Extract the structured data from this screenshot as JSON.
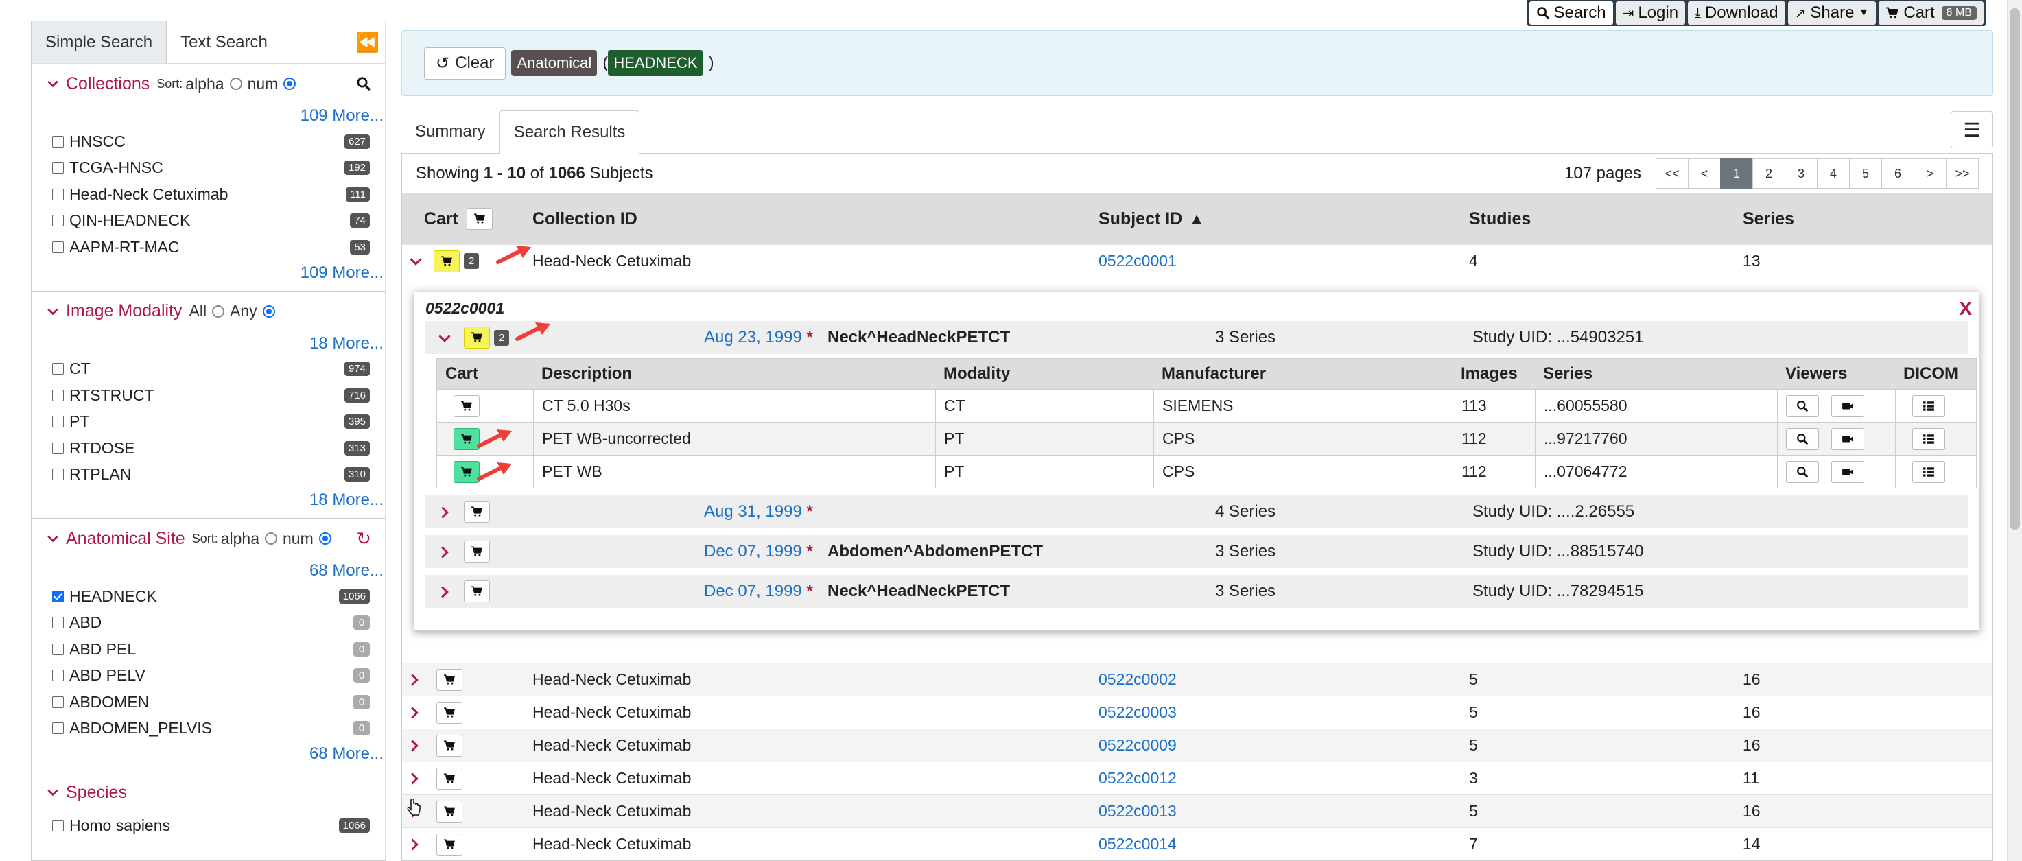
{
  "toolbar": {
    "search_label": "Search",
    "login_label": "Login",
    "download_label": "Download",
    "share_label": "Share",
    "cart_label": "Cart",
    "cart_size": "8 MB"
  },
  "sidebar": {
    "tabs": [
      "Simple Search",
      "Text Search"
    ],
    "collections": {
      "title": "Collections",
      "sort_label": "Sort:",
      "sort_alpha": "alpha",
      "sort_num": "num",
      "more_top": "109 More...",
      "more_bottom": "109 More...",
      "items": [
        {
          "label": "HNSCC",
          "count": "627"
        },
        {
          "label": "TCGA-HNSC",
          "count": "192"
        },
        {
          "label": "Head-Neck Cetuximab",
          "count": "111"
        },
        {
          "label": "QIN-HEADNECK",
          "count": "74"
        },
        {
          "label": "AAPM-RT-MAC",
          "count": "53"
        }
      ]
    },
    "modality": {
      "title": "Image Modality",
      "all_label": "All",
      "any_label": "Any",
      "more_top": "18 More...",
      "more_bottom": "18 More...",
      "items": [
        {
          "label": "CT",
          "count": "974"
        },
        {
          "label": "RTSTRUCT",
          "count": "716"
        },
        {
          "label": "PT",
          "count": "395"
        },
        {
          "label": "RTDOSE",
          "count": "313"
        },
        {
          "label": "RTPLAN",
          "count": "310"
        }
      ]
    },
    "anatomical": {
      "title": "Anatomical Site",
      "sort_label": "Sort:",
      "sort_alpha": "alpha",
      "sort_num": "num",
      "more_top": "68 More...",
      "more_bottom": "68 More...",
      "items": [
        {
          "label": "HEADNECK",
          "count": "1066"
        },
        {
          "label": "ABD",
          "count": "0"
        },
        {
          "label": "ABD PEL",
          "count": "0"
        },
        {
          "label": "ABD PELV",
          "count": "0"
        },
        {
          "label": "ABDOMEN",
          "count": "0"
        },
        {
          "label": "ABDOMEN_PELVIS",
          "count": "0"
        }
      ]
    },
    "species": {
      "title": "Species",
      "items": [
        {
          "label": "Homo sapiens",
          "count": "1066"
        }
      ]
    }
  },
  "filter": {
    "clear_label": "Clear",
    "category": "Anatomical",
    "value": "HEADNECK",
    "open_paren": "(",
    "close_paren": ")"
  },
  "tabs": [
    "Summary",
    "Search Results"
  ],
  "results": {
    "showing_prefix": "Showing",
    "range": "1 - 10",
    "of_label": "of",
    "total": "1066",
    "unit": "Subjects",
    "pages_label": "107 pages",
    "pager": [
      "<<",
      "<",
      "1",
      "2",
      "3",
      "4",
      "5",
      "6",
      ">",
      ">>"
    ],
    "headers": {
      "cart": "Cart",
      "collection": "Collection ID",
      "subject": "Subject ID",
      "studies": "Studies",
      "series": "Series"
    },
    "rows": [
      {
        "collection": "Head-Neck Cetuximab",
        "subject": "0522c0001",
        "studies": "4",
        "series": "13",
        "cart_count": "2"
      },
      {
        "collection": "Head-Neck Cetuximab",
        "subject": "0522c0002",
        "studies": "5",
        "series": "16"
      },
      {
        "collection": "Head-Neck Cetuximab",
        "subject": "0522c0003",
        "studies": "5",
        "series": "16"
      },
      {
        "collection": "Head-Neck Cetuximab",
        "subject": "0522c0009",
        "studies": "5",
        "series": "16"
      },
      {
        "collection": "Head-Neck Cetuximab",
        "subject": "0522c0012",
        "studies": "3",
        "series": "11"
      },
      {
        "collection": "Head-Neck Cetuximab",
        "subject": "0522c0013",
        "studies": "5",
        "series": "16"
      },
      {
        "collection": "Head-Neck Cetuximab",
        "subject": "0522c0014",
        "studies": "7",
        "series": "14"
      }
    ]
  },
  "detail": {
    "subject_id": "0522c0001",
    "close_label": "X",
    "star": "*",
    "studies": [
      {
        "date": "Aug 23, 1999",
        "desc": "Neck^HeadNeckPETCT",
        "series": "3 Series",
        "uid": "Study UID: ...54903251",
        "cart_count": "2"
      },
      {
        "date": "Aug 31, 1999",
        "desc": "",
        "series": "4 Series",
        "uid": "Study UID: ....2.26555"
      },
      {
        "date": "Dec 07, 1999",
        "desc": "Abdomen^AbdomenPETCT",
        "series": "3 Series",
        "uid": "Study UID: ...88515740"
      },
      {
        "date": "Dec 07, 1999",
        "desc": "Neck^HeadNeckPETCT",
        "series": "3 Series",
        "uid": "Study UID: ...78294515"
      }
    ],
    "series_headers": {
      "cart": "Cart",
      "desc": "Description",
      "modality": "Modality",
      "manufacturer": "Manufacturer",
      "images": "Images",
      "series": "Series",
      "viewers": "Viewers",
      "dicom": "DICOM"
    },
    "series_rows": [
      {
        "desc": "CT 5.0 H30s",
        "modality": "CT",
        "manufacturer": "SIEMENS",
        "images": "113",
        "series": "...60055580"
      },
      {
        "desc": "PET WB-uncorrected",
        "modality": "PT",
        "manufacturer": "CPS",
        "images": "112",
        "series": "...97217760"
      },
      {
        "desc": "PET WB",
        "modality": "PT",
        "manufacturer": "CPS",
        "images": "112",
        "series": "...07064772"
      }
    ]
  },
  "colors": {
    "accent": "#b0174b",
    "link": "#1a6fc9",
    "cart_yellow": "#f7f35a",
    "cart_green": "#4fe0a0"
  }
}
